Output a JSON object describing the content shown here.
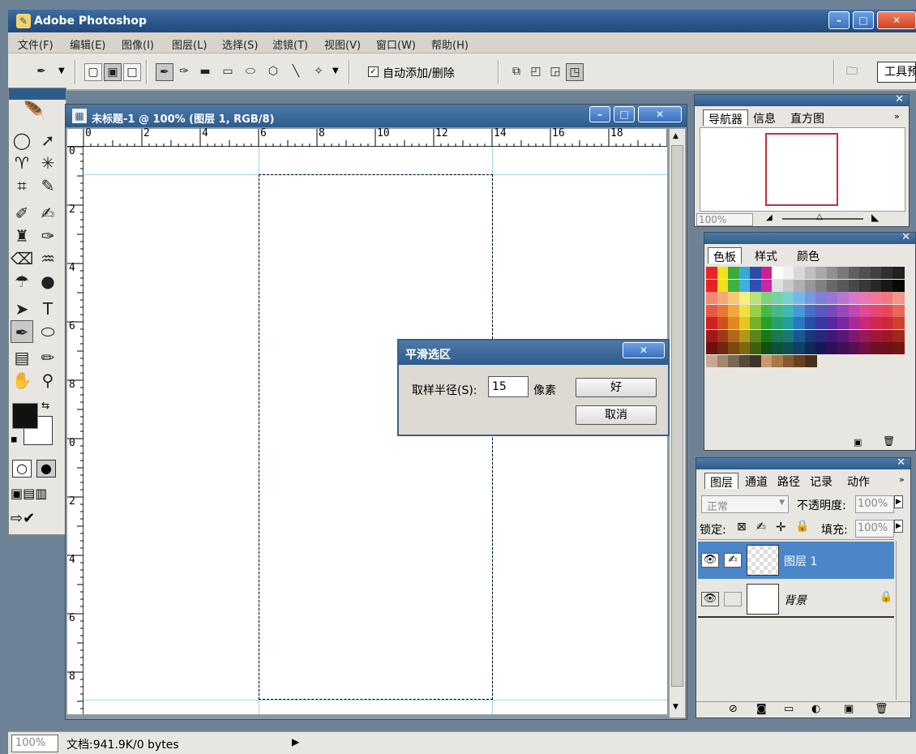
{
  "app": {
    "title": "Adobe Photoshop"
  },
  "menu": [
    "文件(F)",
    "编辑(E)",
    "图像(I)",
    "图层(L)",
    "选择(S)",
    "滤镜(T)",
    "视图(V)",
    "窗口(W)",
    "帮助(H)"
  ],
  "options": {
    "auto_add_delete": "自动添加/删除",
    "tool_presets_label": "工具预"
  },
  "document": {
    "title": "未标题-1 @ 100% (图层 1, RGB/8)"
  },
  "ruler": {
    "h_labels": [
      "0",
      "2",
      "4",
      "6",
      "8",
      "10",
      "12",
      "14",
      "16",
      "18"
    ],
    "v_labels": [
      "0",
      "2",
      "4",
      "6",
      "8",
      "0",
      "2",
      "4",
      "6",
      "8"
    ]
  },
  "dialog": {
    "title": "平滑选区",
    "radius_label": "取样半径(S):",
    "radius_value": "15",
    "unit": "像素",
    "ok": "好",
    "cancel": "取消"
  },
  "navigator": {
    "tabs": [
      "导航器",
      "信息",
      "直方图"
    ],
    "zoom": "100%"
  },
  "swatches": {
    "tabs": [
      "色板",
      "样式",
      "颜色"
    ],
    "colors": [
      [
        "#e8242c",
        "#f5e21c",
        "#3aaa3a",
        "#38a8d8",
        "#2c4aa8",
        "#d02090",
        "#ffffff",
        "#f0f0f0",
        "#d8d8d8",
        "#c0c0c0",
        "#a8a8a8",
        "#909090",
        "#787878",
        "#606060",
        "#505050",
        "#404040",
        "#303030",
        "#202020"
      ],
      [
        "#e82020",
        "#f0e020",
        "#40b040",
        "#40b0e0",
        "#3050b0",
        "#c828a0",
        "#e0e0e0",
        "#c8c8c8",
        "#b0b0b0",
        "#989898",
        "#808080",
        "#686868",
        "#585858",
        "#484848",
        "#383838",
        "#282828",
        "#181818",
        "#080808"
      ],
      [
        "#f08878",
        "#f0a878",
        "#f8c878",
        "#f8f080",
        "#b8e080",
        "#80d080",
        "#78d0a8",
        "#78d0d0",
        "#78b8e8",
        "#7898e0",
        "#8080d8",
        "#9878d0",
        "#b878d0",
        "#d878c8",
        "#e878b0",
        "#f07898",
        "#f07880",
        "#f09888"
      ],
      [
        "#e85848",
        "#e87838",
        "#f0a838",
        "#f0e040",
        "#98d048",
        "#48b848",
        "#48b888",
        "#40b8b8",
        "#4898d8",
        "#4870c8",
        "#5858c0",
        "#7848b8",
        "#9848b8",
        "#c048b0",
        "#e04898",
        "#e84870",
        "#e84858",
        "#e86858"
      ],
      [
        "#d02020",
        "#d05020",
        "#e08820",
        "#e0c820",
        "#78b028",
        "#28a028",
        "#28a070",
        "#20a0a0",
        "#2878c0",
        "#2850a8",
        "#3838a0",
        "#5828a0",
        "#7828a0",
        "#a82898",
        "#c82878",
        "#d02850",
        "#d02838",
        "#d04030"
      ],
      [
        "#a01818",
        "#a03818",
        "#b06818",
        "#b09818",
        "#588818",
        "#187818",
        "#187850",
        "#187878",
        "#185890",
        "#183878",
        "#282878",
        "#401878",
        "#581878",
        "#801870",
        "#981858",
        "#a01838",
        "#a01828",
        "#a02818"
      ],
      [
        "#701010",
        "#702810",
        "#804810",
        "#806810",
        "#406010",
        "#105010",
        "#105038",
        "#105050",
        "#104068",
        "#102858",
        "#181858",
        "#301058",
        "#401058",
        "#581050",
        "#701040",
        "#701028",
        "#701018",
        "#701810"
      ],
      [
        "#c8a890",
        "#a08870",
        "#786858",
        "#584838",
        "#403428",
        "#c89870",
        "#a87848",
        "#885830",
        "#684020",
        "#483018"
      ]
    ]
  },
  "layers": {
    "tabs": [
      "图层",
      "通道",
      "路径",
      "记录",
      "动作"
    ],
    "blend_mode": "正常",
    "opacity_label": "不透明度:",
    "opacity_value": "100%",
    "lock_label": "锁定:",
    "fill_label": "填充:",
    "fill_value": "100%",
    "items": [
      {
        "name": "图层 1",
        "selected": true
      },
      {
        "name": "背景",
        "selected": false
      }
    ]
  },
  "status": {
    "zoom": "100%",
    "doc_info": "文档:941.9K/0 bytes"
  },
  "colors": {
    "title_blue": "#2d5c8c",
    "guide": "#9fd6e8",
    "selected_layer": "#4a86c8"
  }
}
